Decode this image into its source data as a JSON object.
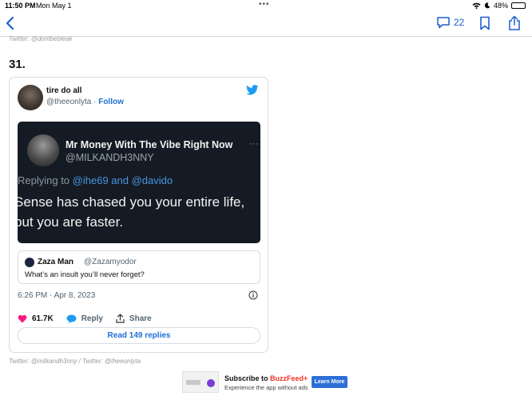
{
  "status_bar": {
    "time": "11:50 PM",
    "date": "Mon May 1",
    "battery": "48%",
    "battery_level": 0.48
  },
  "toolbar": {
    "comment_count": "22"
  },
  "top_credit": "Twitter: @dontbebleak",
  "item_number": "31.",
  "tweet": {
    "author_name": "tire do all",
    "author_handle": "@theeonlyta",
    "separator": "·",
    "follow_label": "Follow",
    "embedded_screenshot": {
      "name": "Mr Money With The Vibe Right Now",
      "handle": "@MILKANDH3NNY",
      "replying_prefix": "Replying to",
      "replying_mentions": "@ihe69 and @davido",
      "text_line1": "Sense has chased you your entire life,",
      "text_line2": "but you are faster."
    },
    "quote": {
      "name": "Zaza Man",
      "handle": "@Zazamyodor",
      "text": "What’s an insult you’ll never forget?"
    },
    "timestamp": "6:26 PM · Apr 8, 2023",
    "like_count": "61.7K",
    "reply_label": "Reply",
    "share_label": "Share",
    "read_replies_label": "Read 149 replies"
  },
  "bottom_credit": "Twitter: @milkandh3nny / Twitter: @theeonlyta",
  "ad": {
    "title_prefix": "Subscribe to",
    "brand": "BuzzFeed+",
    "subtitle": "Experience the app without ads",
    "button_label": "Learn More"
  },
  "colors": {
    "accent": "#1d6fd1",
    "twitter_blue": "#1d9bf0",
    "heart": "#f91880",
    "screenshot_bg": "#151b24"
  }
}
